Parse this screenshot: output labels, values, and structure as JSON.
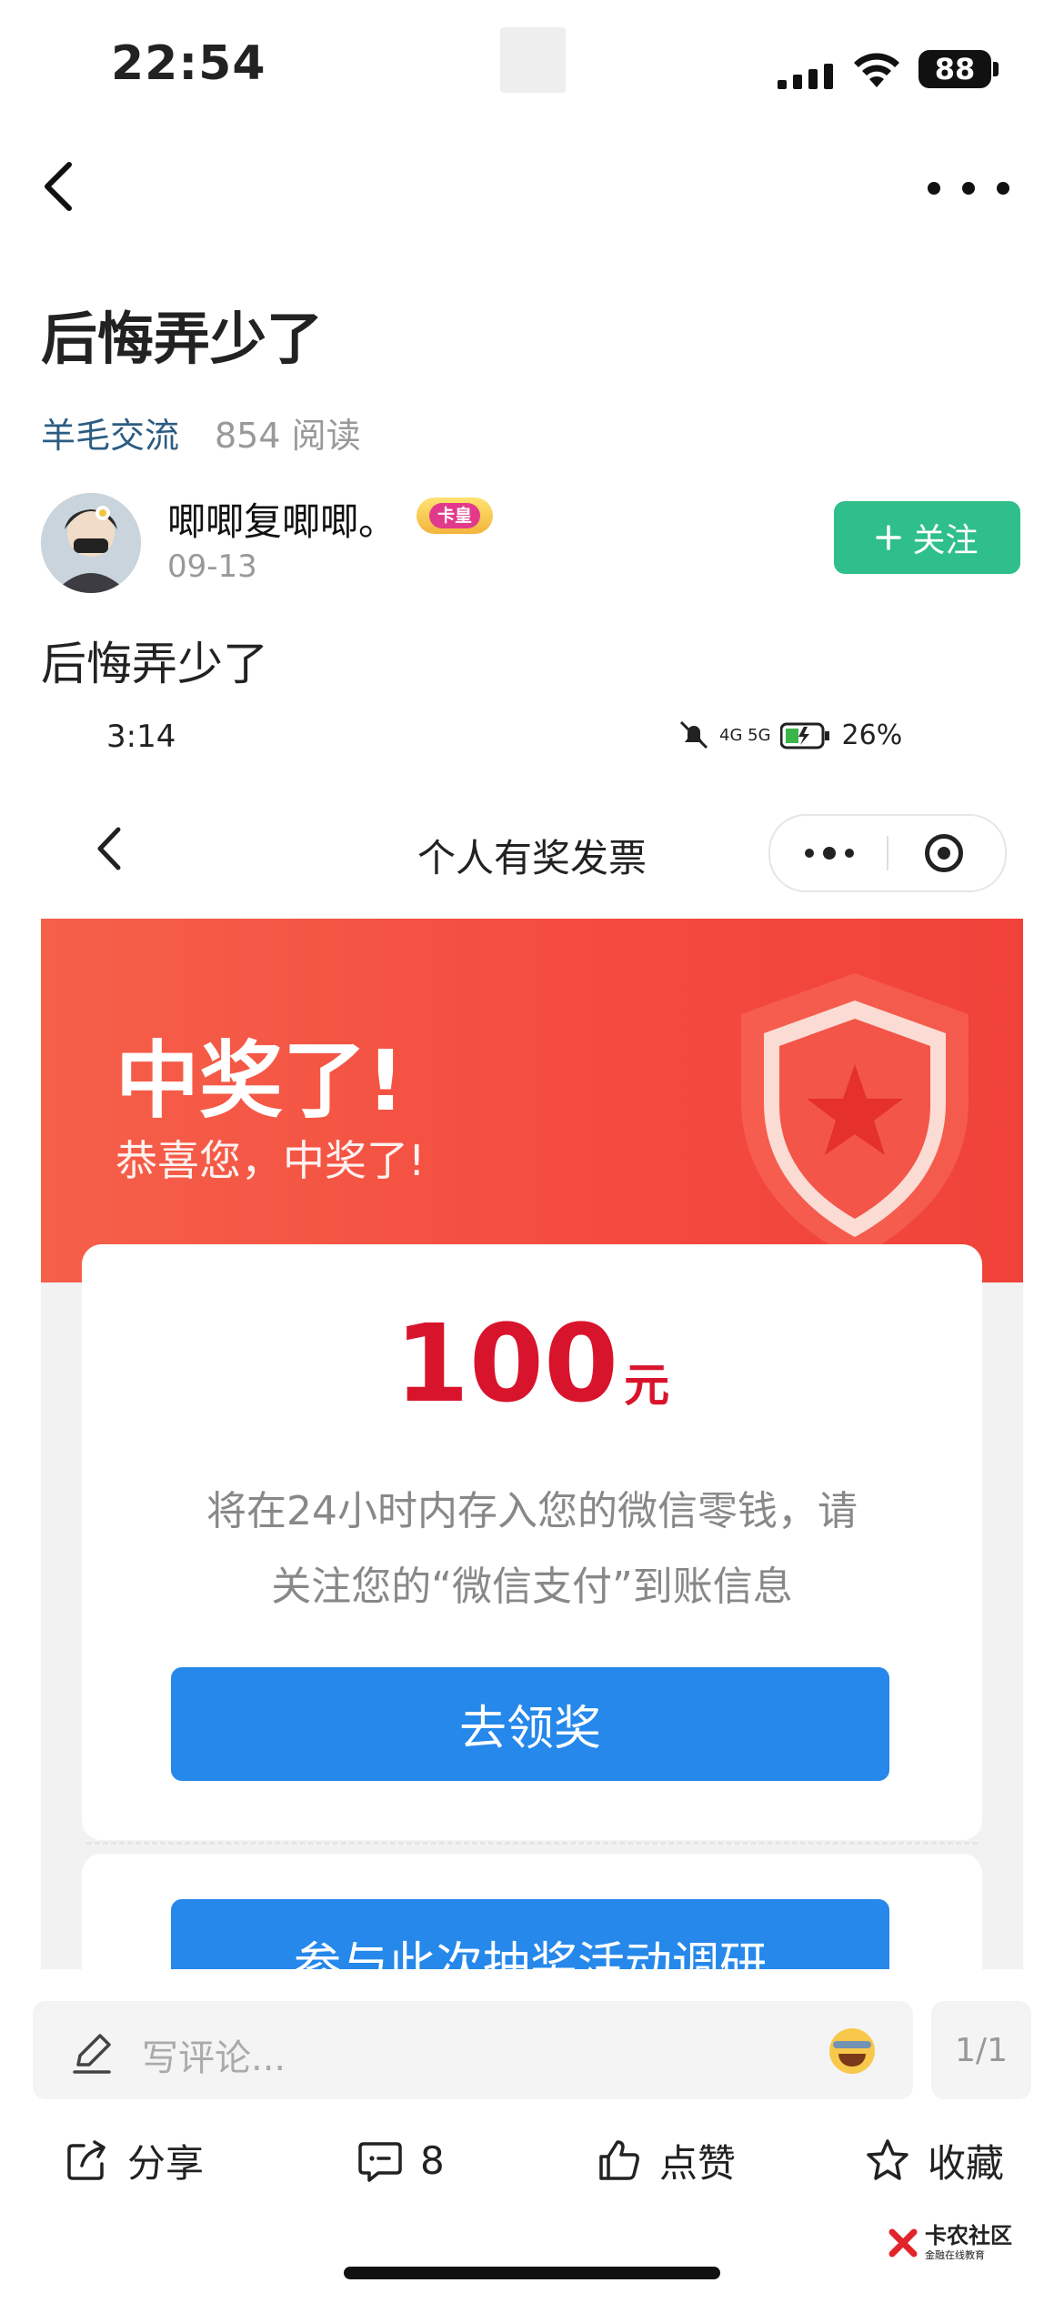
{
  "status_bar": {
    "time": "22:54",
    "battery": "88"
  },
  "nav": {
    "back": "back",
    "more": "more"
  },
  "post": {
    "title": "后悔弄少了",
    "tag": "羊毛交流",
    "reads": "854 阅读",
    "author": {
      "name": "唧唧复唧唧。",
      "badge": "卡皇",
      "date": "09-13"
    },
    "follow_label": "关注",
    "body": "后悔弄少了"
  },
  "embedded": {
    "status_time": "3:14",
    "status_battery": "26%",
    "status_net": "4G 5G",
    "page_title": "个人有奖发票",
    "win_title": "中奖了!",
    "win_subtitle": "恭喜您，中奖了!",
    "amount": "100",
    "unit": "元",
    "desc_line1": "将在24小时内存入您的微信零钱，请",
    "desc_line2": "关注您的“微信支付”到账信息",
    "claim_button": "去领奖",
    "survey_button": "参与此次抽奖活动调研",
    "accent_red": "#d8142c",
    "accent_blue": "#2588ea"
  },
  "bottom": {
    "comment_placeholder": "写评论...",
    "page": "1/1",
    "share": "分享",
    "comments": "8",
    "like": "点赞",
    "favorite": "收藏"
  },
  "watermark": {
    "title": "卡农社区",
    "subtitle": "金融在线教育"
  },
  "colors": {
    "follow": "#2fbf8a",
    "tag": "#2b5c82"
  }
}
